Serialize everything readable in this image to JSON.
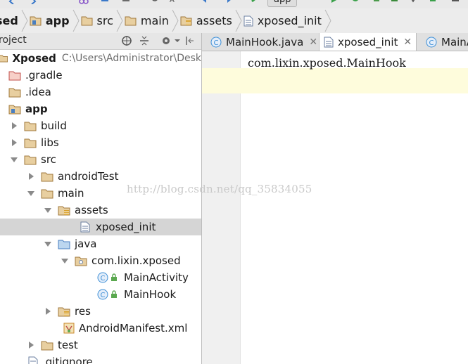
{
  "toolbar": {
    "run_config": "app"
  },
  "breadcrumb": {
    "items": [
      {
        "label": "sed",
        "icon": "project-icon"
      },
      {
        "label": "app",
        "icon": "module-folder-icon"
      },
      {
        "label": "src",
        "icon": "folder-icon"
      },
      {
        "label": "main",
        "icon": "folder-icon"
      },
      {
        "label": "assets",
        "icon": "assets-folder-icon"
      },
      {
        "label": "xposed_init",
        "icon": "text-file-icon"
      }
    ]
  },
  "project_panel": {
    "title": "roject"
  },
  "tabs": [
    {
      "label": "MainHook.java",
      "icon": "java-class-icon"
    },
    {
      "label": "xposed_init",
      "icon": "text-file-icon",
      "active": true
    },
    {
      "label": "MainA",
      "icon": "java-class-icon"
    }
  ],
  "tree": [
    {
      "label": "Xposed",
      "path": "C:\\Users\\Administrator\\Desk",
      "icon": "project-folder-icon",
      "bold": true
    },
    {
      "label": ".gradle",
      "icon": "folder-red-icon"
    },
    {
      "label": ".idea",
      "icon": "folder-icon"
    },
    {
      "label": "app",
      "icon": "module-folder-icon",
      "bold": true
    },
    {
      "label": "build",
      "icon": "folder-icon"
    },
    {
      "label": "libs",
      "icon": "folder-icon"
    },
    {
      "label": "src",
      "icon": "folder-icon"
    },
    {
      "label": "androidTest",
      "icon": "folder-icon"
    },
    {
      "label": "main",
      "icon": "folder-icon"
    },
    {
      "label": "assets",
      "icon": "assets-folder-icon"
    },
    {
      "label": "xposed_init",
      "icon": "text-file-icon",
      "selected": true
    },
    {
      "label": "java",
      "icon": "source-folder-icon"
    },
    {
      "label": "com.lixin.xposed",
      "icon": "package-icon"
    },
    {
      "label": "MainActivity",
      "icon": "java-class-icon"
    },
    {
      "label": "MainHook",
      "icon": "java-class-icon"
    },
    {
      "label": "res",
      "icon": "res-folder-icon"
    },
    {
      "label": "AndroidManifest.xml",
      "icon": "manifest-icon"
    },
    {
      "label": "test",
      "icon": "folder-icon"
    },
    {
      "label": ".gitignore",
      "icon": "text-file-icon"
    }
  ],
  "editor": {
    "line1": "com.lixin.xposed.MainHook"
  },
  "watermark": "http://blog.csdn.net/qq_35834055",
  "colors": {
    "selection": "#d5d5d5",
    "current_line": "#fefcdc",
    "folder": "#c9a16b",
    "java_class": "#3d8fd6",
    "lock_green": "#5aa84f"
  }
}
